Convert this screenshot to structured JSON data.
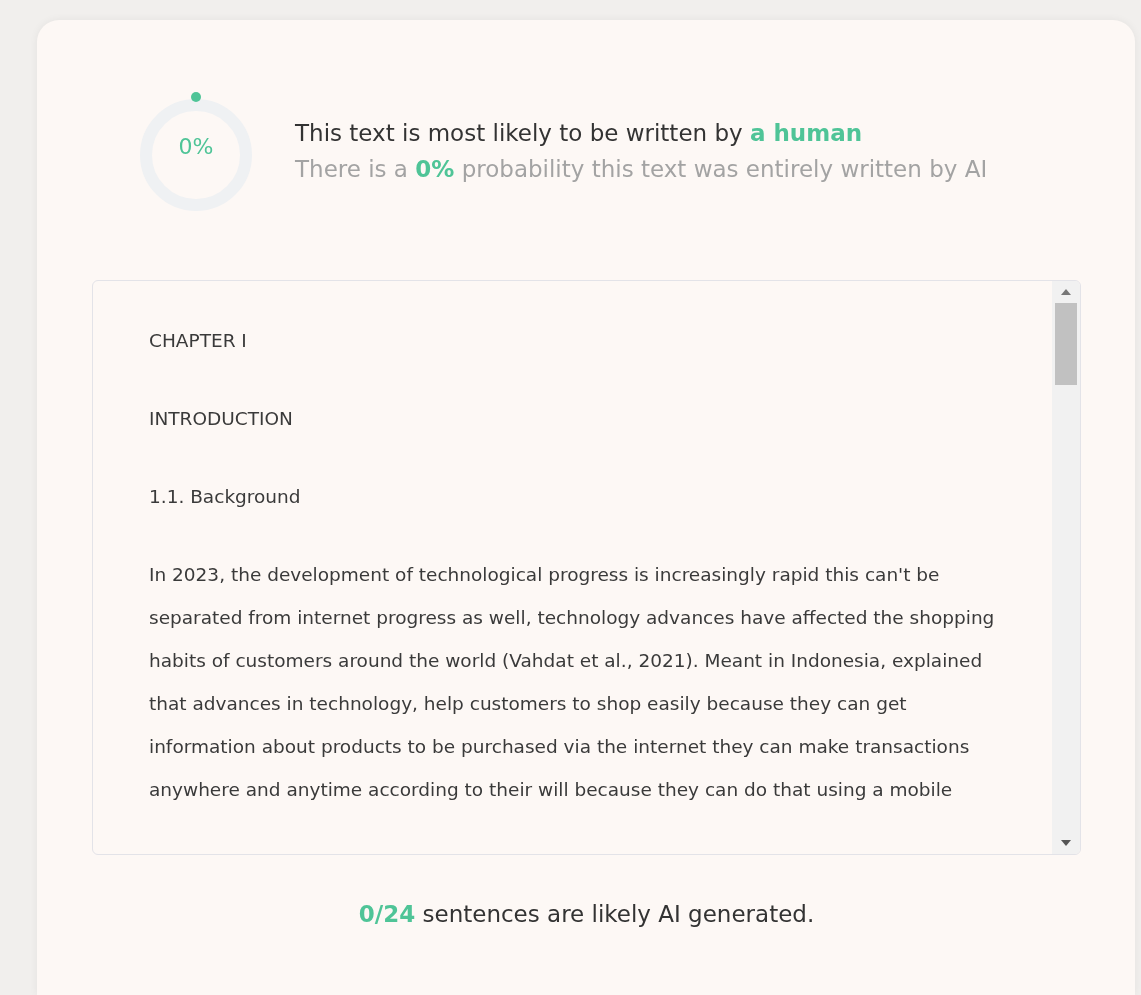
{
  "result": {
    "gauge": {
      "label": "0%"
    },
    "headline": "This text is most likely to be written by **a human**",
    "subline": "There is a **0%** probability this text was entirely written by AI"
  },
  "document": {
    "paragraphs": [
      "CHAPTER I",
      "INTRODUCTION",
      "1.1. Background",
      "In 2023, the development of technological progress is increasingly rapid this can't be separated from internet progress as well, technology advances have affected the shopping habits of customers around the world (Vahdat et al., 2021). Meant in Indonesia, explained that advances in technology, help customers to shop easily because they can get information about products to be purchased via the internet they can make transactions anywhere and anytime according to their will because they can do that using a mobile"
    ]
  },
  "summary": "**0/24** sentences are likely AI generated."
}
